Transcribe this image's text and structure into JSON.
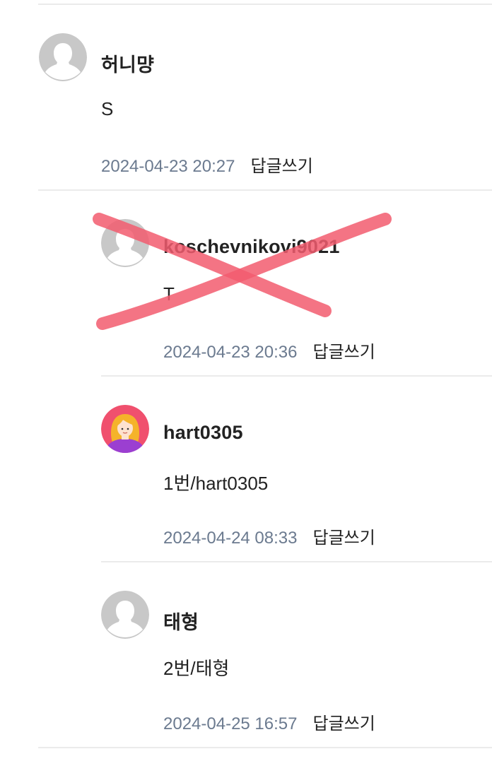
{
  "comments": [
    {
      "author": "허니먕",
      "body": "S",
      "date": "2024-04-23 20:27",
      "reply_label": "답글쓰기",
      "avatar": "default-user-avatar"
    },
    {
      "author": "koschevnikovi9021",
      "body": "T",
      "date": "2024-04-23 20:36",
      "reply_label": "답글쓰기",
      "avatar": "default-user-avatar",
      "crossed_out": true
    },
    {
      "author": "hart0305",
      "body": "1번/hart0305",
      "date": "2024-04-24 08:33",
      "reply_label": "답글쓰기",
      "avatar": "girl-character-avatar"
    },
    {
      "author": "태형",
      "body": "2번/태형",
      "date": "2024-04-25 16:57",
      "reply_label": "답글쓰기",
      "avatar": "default-user-avatar"
    }
  ],
  "colors": {
    "date": "#6b7a8f",
    "divider": "#ebebeb",
    "cross_mark": "#f25c6e",
    "avatar_default": "#c8c8c8"
  }
}
